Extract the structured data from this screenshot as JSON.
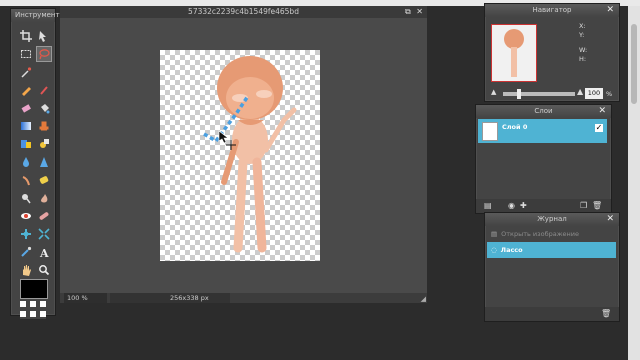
{
  "toolbox": {
    "title": "Инструмент"
  },
  "document": {
    "title": "57332c2239c4b1549fe465bd",
    "zoom": "100",
    "zoom_unit": "%",
    "dimensions": "256x338 px"
  },
  "navigator": {
    "title": "Навигатор",
    "x_label": "X:",
    "y_label": "Y:",
    "w_label": "W:",
    "h_label": "H:",
    "zoom": "100",
    "zoom_unit": "%"
  },
  "layers": {
    "title": "Слои",
    "items": [
      {
        "name": "Слой 0",
        "visible": true
      }
    ]
  },
  "history": {
    "title": "Журнал",
    "items": [
      {
        "label": "Открыть изображение"
      },
      {
        "label": "Лассо",
        "selected": true
      }
    ]
  },
  "colors": {
    "accent": "#4fb3d3",
    "primary_color": "#000000"
  }
}
